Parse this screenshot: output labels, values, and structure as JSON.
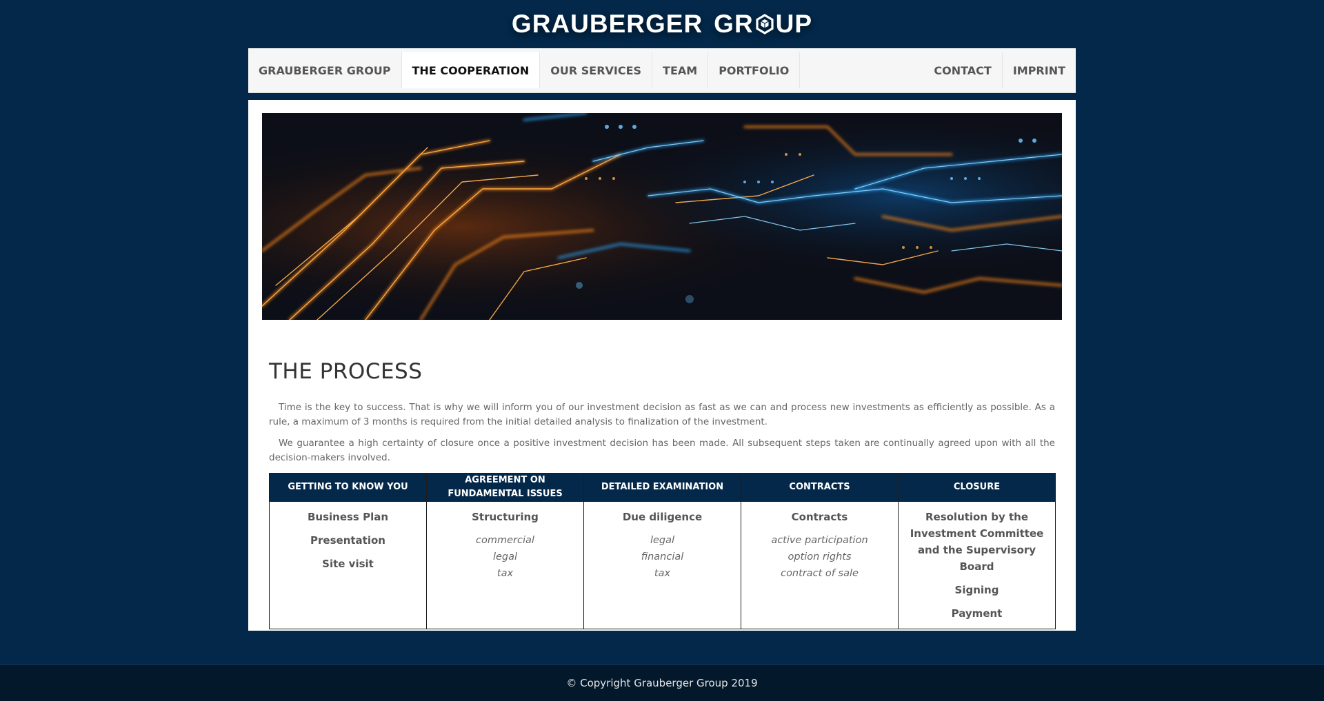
{
  "logo": {
    "word1": "GRAUBERGER",
    "word2_start": "GR",
    "word2_end": "UP",
    "symbol": "hexagon-cube-icon"
  },
  "nav": {
    "left": [
      {
        "label": "GRAUBERGER GROUP",
        "active": false
      },
      {
        "label": "THE COOPERATION",
        "active": true
      },
      {
        "label": "OUR SERVICES",
        "active": false
      },
      {
        "label": "TEAM",
        "active": false
      },
      {
        "label": "PORTFOLIO",
        "active": false
      }
    ],
    "right": [
      {
        "label": "CONTACT"
      },
      {
        "label": "IMPRINT"
      }
    ]
  },
  "hero": {
    "image": "circuit-board-image"
  },
  "main": {
    "title": "THE PROCESS",
    "paragraphs": [
      "Time is the key to success. That is why we will inform you of our investment decision as fast as we can and process new investments as efficiently as possible. As a rule, a maximum of 3 months is required from the initial detailed analysis to finalization of the investment.",
      "We guarantee a high certainty of closure once a positive investment decision has been made. All subsequent steps taken are continually agreed upon with all the decision-makers involved."
    ]
  },
  "process_table": {
    "headers": [
      "GETTING TO KNOW YOU",
      "AGREEMENT ON FUNDAMENTAL ISSUES",
      "DETAILED EXAMINATION",
      "CONTRACTS",
      "CLOSURE"
    ],
    "columns": [
      {
        "main": [
          "Business Plan",
          "Presentation",
          "Site visit"
        ],
        "sub": []
      },
      {
        "main": [
          "Structuring"
        ],
        "sub": [
          "commercial",
          "legal",
          "tax"
        ]
      },
      {
        "main": [
          "Due diligence"
        ],
        "sub": [
          "legal",
          "financial",
          "tax"
        ]
      },
      {
        "main": [
          "Contracts"
        ],
        "sub": [
          "active participation",
          "option rights",
          "contract of sale"
        ]
      },
      {
        "main": [
          "Resolution by the Investment Committee and the Supervisory Board",
          "Signing",
          "Payment"
        ],
        "sub": []
      }
    ]
  },
  "footer": {
    "text": "© Copyright Grauberger Group 2019"
  },
  "colors": {
    "background": "#03284a",
    "table_header": "#03284a",
    "footer": "#03182b",
    "nav": "#f6f6f6"
  }
}
